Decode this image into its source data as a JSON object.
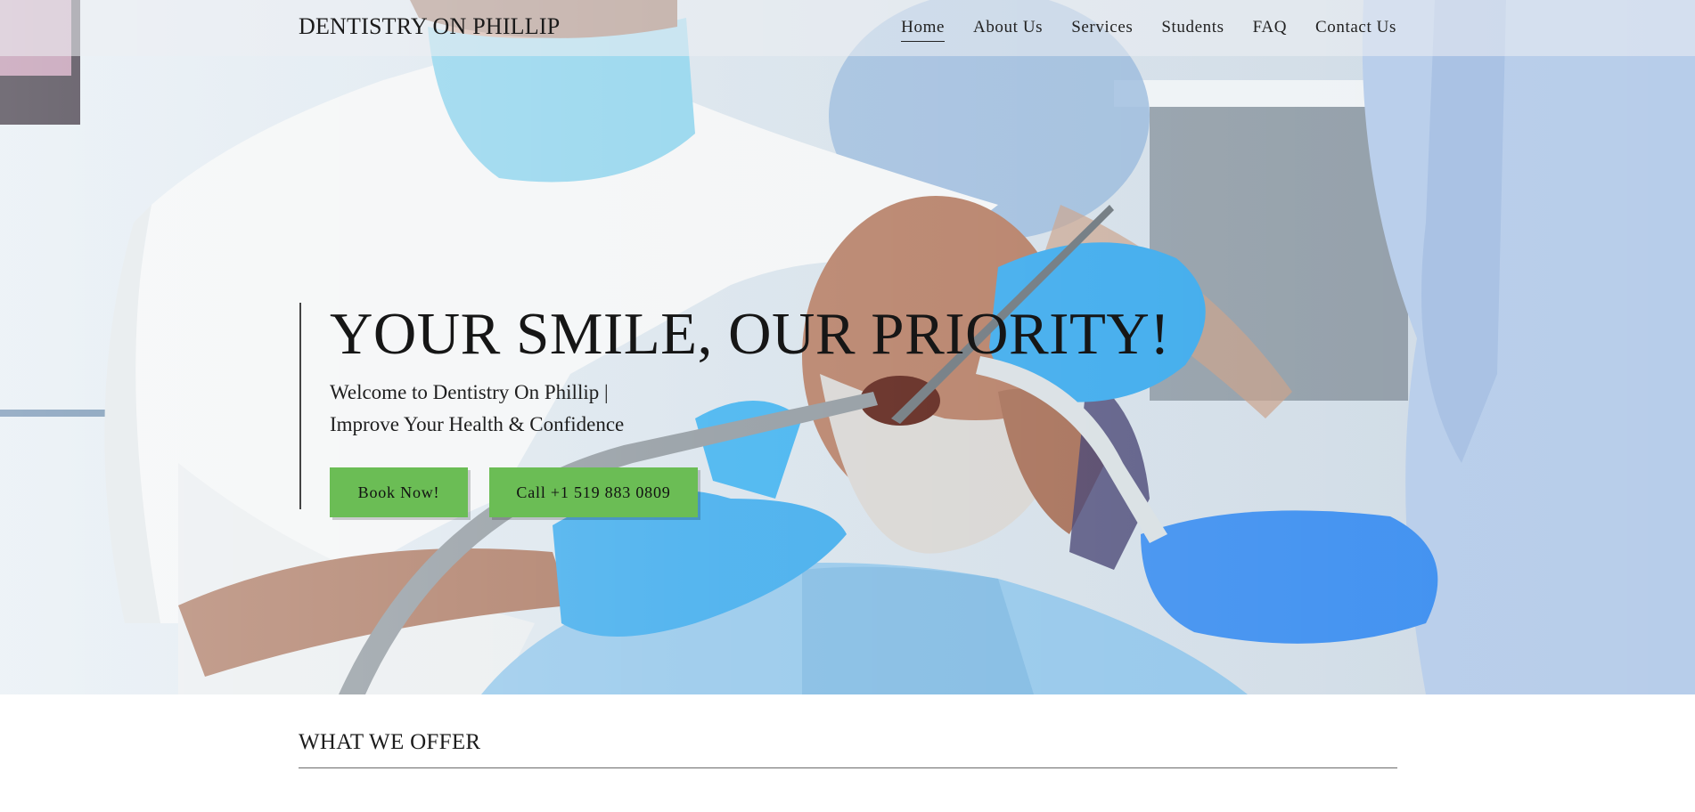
{
  "site": {
    "logo": "DENTISTRY ON PHILLIP"
  },
  "nav": {
    "items": [
      {
        "label": "Home",
        "active": true
      },
      {
        "label": "About Us"
      },
      {
        "label": "Services"
      },
      {
        "label": "Students"
      },
      {
        "label": "FAQ"
      },
      {
        "label": "Contact Us"
      }
    ]
  },
  "hero": {
    "headline": "YOUR SMILE, OUR PRIORITY!",
    "subline_1": "Welcome to Dentistry On Phillip |",
    "subline_2": "Improve Your Health & Confidence",
    "buttons": {
      "book": "Book Now!",
      "call": "Call +1 519 883 0809"
    },
    "image": "dental-exam-photo"
  },
  "section": {
    "title": "WHAT WE OFFER"
  },
  "colors": {
    "accent_button": "#6bbd55",
    "text": "#1b1b1b"
  }
}
